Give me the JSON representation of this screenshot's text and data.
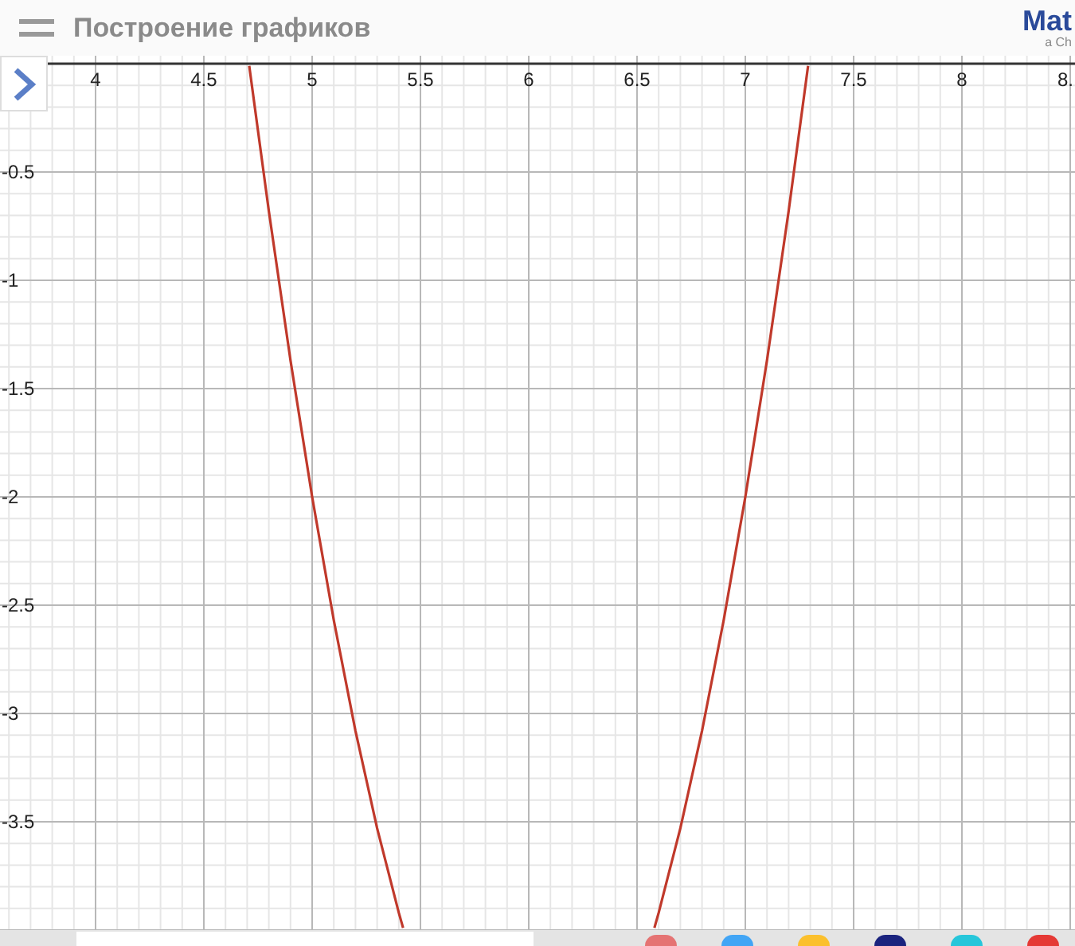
{
  "header": {
    "title": "Построение графиков",
    "logo": "Mat",
    "logo_subtitle": "a Ch"
  },
  "graph": {
    "chart_data": {
      "type": "line",
      "grid": true,
      "xlim": [
        3.559,
        8.522
      ],
      "ylim": [
        -4,
        0.037
      ],
      "xticks": [
        4,
        4.5,
        5,
        5.5,
        6,
        6.5,
        7,
        7.5,
        8,
        {
          "value": 8.5,
          "label": "8."
        }
      ],
      "yticks": [
        -0.5,
        -1,
        -1.5,
        -2,
        -2.5,
        -3,
        -3.5
      ],
      "x": [
        4.71,
        4.8,
        4.9,
        5.0,
        5.1,
        5.2,
        5.3,
        5.4,
        5.42,
        6.58,
        6.6,
        6.7,
        6.8,
        6.9,
        7.0,
        7.1,
        7.2,
        7.29
      ],
      "series": [
        {
          "color": "#c0392b",
          "values": [
            -0.01,
            -0.68,
            -1.37,
            -2,
            -2.57,
            -3.08,
            -3.53,
            -3.92,
            -3.99,
            null,
            null,
            null,
            null,
            null,
            null,
            null,
            null,
            null
          ]
        },
        {
          "color": "#c0392b",
          "values": [
            null,
            null,
            null,
            null,
            null,
            null,
            null,
            null,
            null,
            -3.99,
            -3.92,
            -3.53,
            -3.08,
            -2.57,
            -2,
            -1.37,
            -0.68,
            -0.01
          ]
        }
      ]
    }
  },
  "taskbar": {
    "apps": [
      {
        "color": "#e57373"
      },
      {
        "color": "#42a5f5"
      },
      {
        "color": "#fbc02d"
      },
      {
        "color": "#1a237e"
      },
      {
        "color": "#26c6da"
      },
      {
        "color": "#e53935"
      }
    ]
  }
}
